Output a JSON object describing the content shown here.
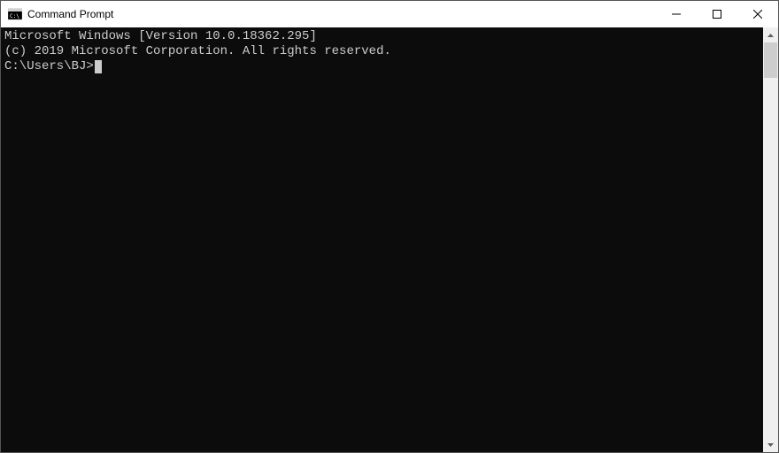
{
  "window": {
    "title": "Command Prompt"
  },
  "terminal": {
    "line1": "Microsoft Windows [Version 10.0.18362.295]",
    "line2": "(c) 2019 Microsoft Corporation. All rights reserved.",
    "blank": "",
    "prompt": "C:\\Users\\BJ>"
  }
}
